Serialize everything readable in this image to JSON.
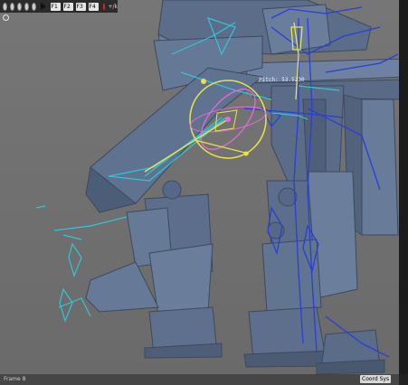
{
  "toolbar": {
    "keys": [
      "F1",
      "F2",
      "F3",
      "F4"
    ],
    "label": "+/k"
  },
  "viewport": {
    "readout": "Pitch: 53.5230",
    "frame_label": "Frame 8",
    "coord_button": "Coord Sys"
  },
  "colors": {
    "background": "#6f6f6f",
    "model": "#5f728f",
    "bone_cyan": "#2fc6d9",
    "bone_blue": "#2a3fd6",
    "gizmo_yellow": "#e8e44a",
    "gizmo_pink": "#e66ad8"
  },
  "icons": [
    "play-icon",
    "record-icon",
    "viewport-circle-icon"
  ]
}
